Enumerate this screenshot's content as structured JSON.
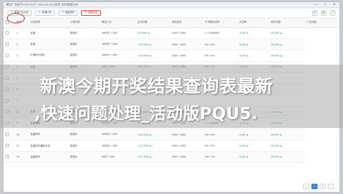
{
  "colors": {
    "accent": "#3b7ddd",
    "danger": "#e03c3c",
    "positive": "#16a34a",
    "overlay": "#aaaaaa"
  },
  "window": {
    "title": "腾讯广告助手2024-05-27~2024-06-02已同步-实时数据分析",
    "controls": [
      "—",
      "□",
      "✕"
    ]
  },
  "toolbar": {
    "buttons": [
      {
        "label": "新建广告计划",
        "icon": "plus-icon"
      },
      {
        "label": "新增计划",
        "icon": "plus-icon"
      },
      {
        "label": "批量操作",
        "icon": "plus-icon"
      },
      {
        "label": "全部计划",
        "icon": "plus-icon"
      }
    ],
    "tools": [
      "⟳",
      "⚙",
      "⤢"
    ]
  },
  "table": {
    "columns": [
      "",
      "序号",
      "计划名称",
      "计划状态",
      "曝光人次",
      "点击次数",
      "转化成本",
      "千次曝光成本",
      "点击率",
      "转化次数",
      "广告消耗"
    ],
    "rows": [
      {
        "id": "1",
        "name": "全量",
        "status": "投放中",
        "c1": "1600万 + 15%",
        "c2": "115.00% ▲",
        "c3": "1000 + 1000",
        "c4": "1 + 0.000000",
        "c5": "14.50 ▲",
        "c6": "25.00% ▲"
      },
      {
        "id": "2",
        "name": "全量",
        "status": "投放中",
        "c1": "1600万 + 15%",
        "c2": "+115.00% ▲",
        "c3": "1000 + 1000",
        "c4": "0% + 0%",
        "c5": "14.50 ▲",
        "c6": "25.00% ▲"
      },
      {
        "id": "3",
        "name": "千禧年代资讯",
        "status": "投放中",
        "c1": "1600万 + 15%",
        "c2": "+115.00% ▲",
        "c3": "1000 + 1000",
        "c4": "0% + 0%",
        "c5": "14.50 ▲",
        "c6": "25.00% ▲"
      },
      {
        "id": "4",
        "name": "全量",
        "status": "投放中",
        "c1": "20万 + 15%",
        "c2": "+117.00% ▲",
        "c3": "1000 + 1000",
        "c4": "0% + 1%",
        "c5": "14.50 ▲",
        "c6": "25.00% ▲"
      },
      {
        "id": "5",
        "name": "",
        "status": "",
        "c1": "",
        "c2": "",
        "c3": "",
        "c4": "",
        "c5": "",
        "c6": ""
      },
      {
        "id": "6",
        "name": "",
        "status": "",
        "c1": "",
        "c2": "",
        "c3": "",
        "c4": "",
        "c5": "",
        "c6": ""
      },
      {
        "id": "7",
        "name": "",
        "status": "",
        "c1": "",
        "c2": "",
        "c3": "",
        "c4": "",
        "c5": "",
        "c6": ""
      },
      {
        "id": "8",
        "name": "全量",
        "status": "投放中",
        "c1": "1600万 + 15%",
        "c2": "+117.00% ▲",
        "c3": "1000 + 1000",
        "c4": "0% + 0%",
        "c5": "14.50 ▲",
        "c6": "25.00% ▲"
      },
      {
        "id": "9",
        "name": "全量通用",
        "status": "投放中",
        "c1": "1600万 + 15%",
        "c2": "115.00% ▲",
        "c3": "1000 + 1000",
        "c4": "1 + 0.000000",
        "c5": "14.50 ▲",
        "c6": "25.00% ▲"
      },
      {
        "id": "10",
        "name": "全量资讯",
        "status": "投放中",
        "c1": "1600万 + 15%",
        "c2": "+115.00% ▲",
        "c3": "1000 + 1000",
        "c4": "0% + 0%",
        "c5": "14.50 ▲",
        "c6": "25.00% ▲"
      },
      {
        "id": "11",
        "name": "全量资讯播放计划",
        "status": "投放中",
        "c1": "1600万 + 15%",
        "c2": "+117.00% ▲",
        "c3": "1000 + 1000",
        "c4": "0% + 0%",
        "c5": "14.50 ▲",
        "c6": "25.00% ▲"
      },
      {
        "id": "12",
        "name": "全量资讯",
        "status": "投放中",
        "c1": "20万 + 15%",
        "c2": "+117.00% ▲",
        "c3": "1000 + 1000",
        "c4": "0% + 1%",
        "c5": "14.50 ▲",
        "c6": "25.00% ▲"
      }
    ]
  },
  "pager": {
    "buttons": [
      "‹",
      "1",
      "2",
      "›"
    ],
    "current": "1"
  },
  "overlay": {
    "line1": "新澳今期开奖结果查询表最新",
    "line2": ",快速问题处理_活动版PQU5."
  }
}
